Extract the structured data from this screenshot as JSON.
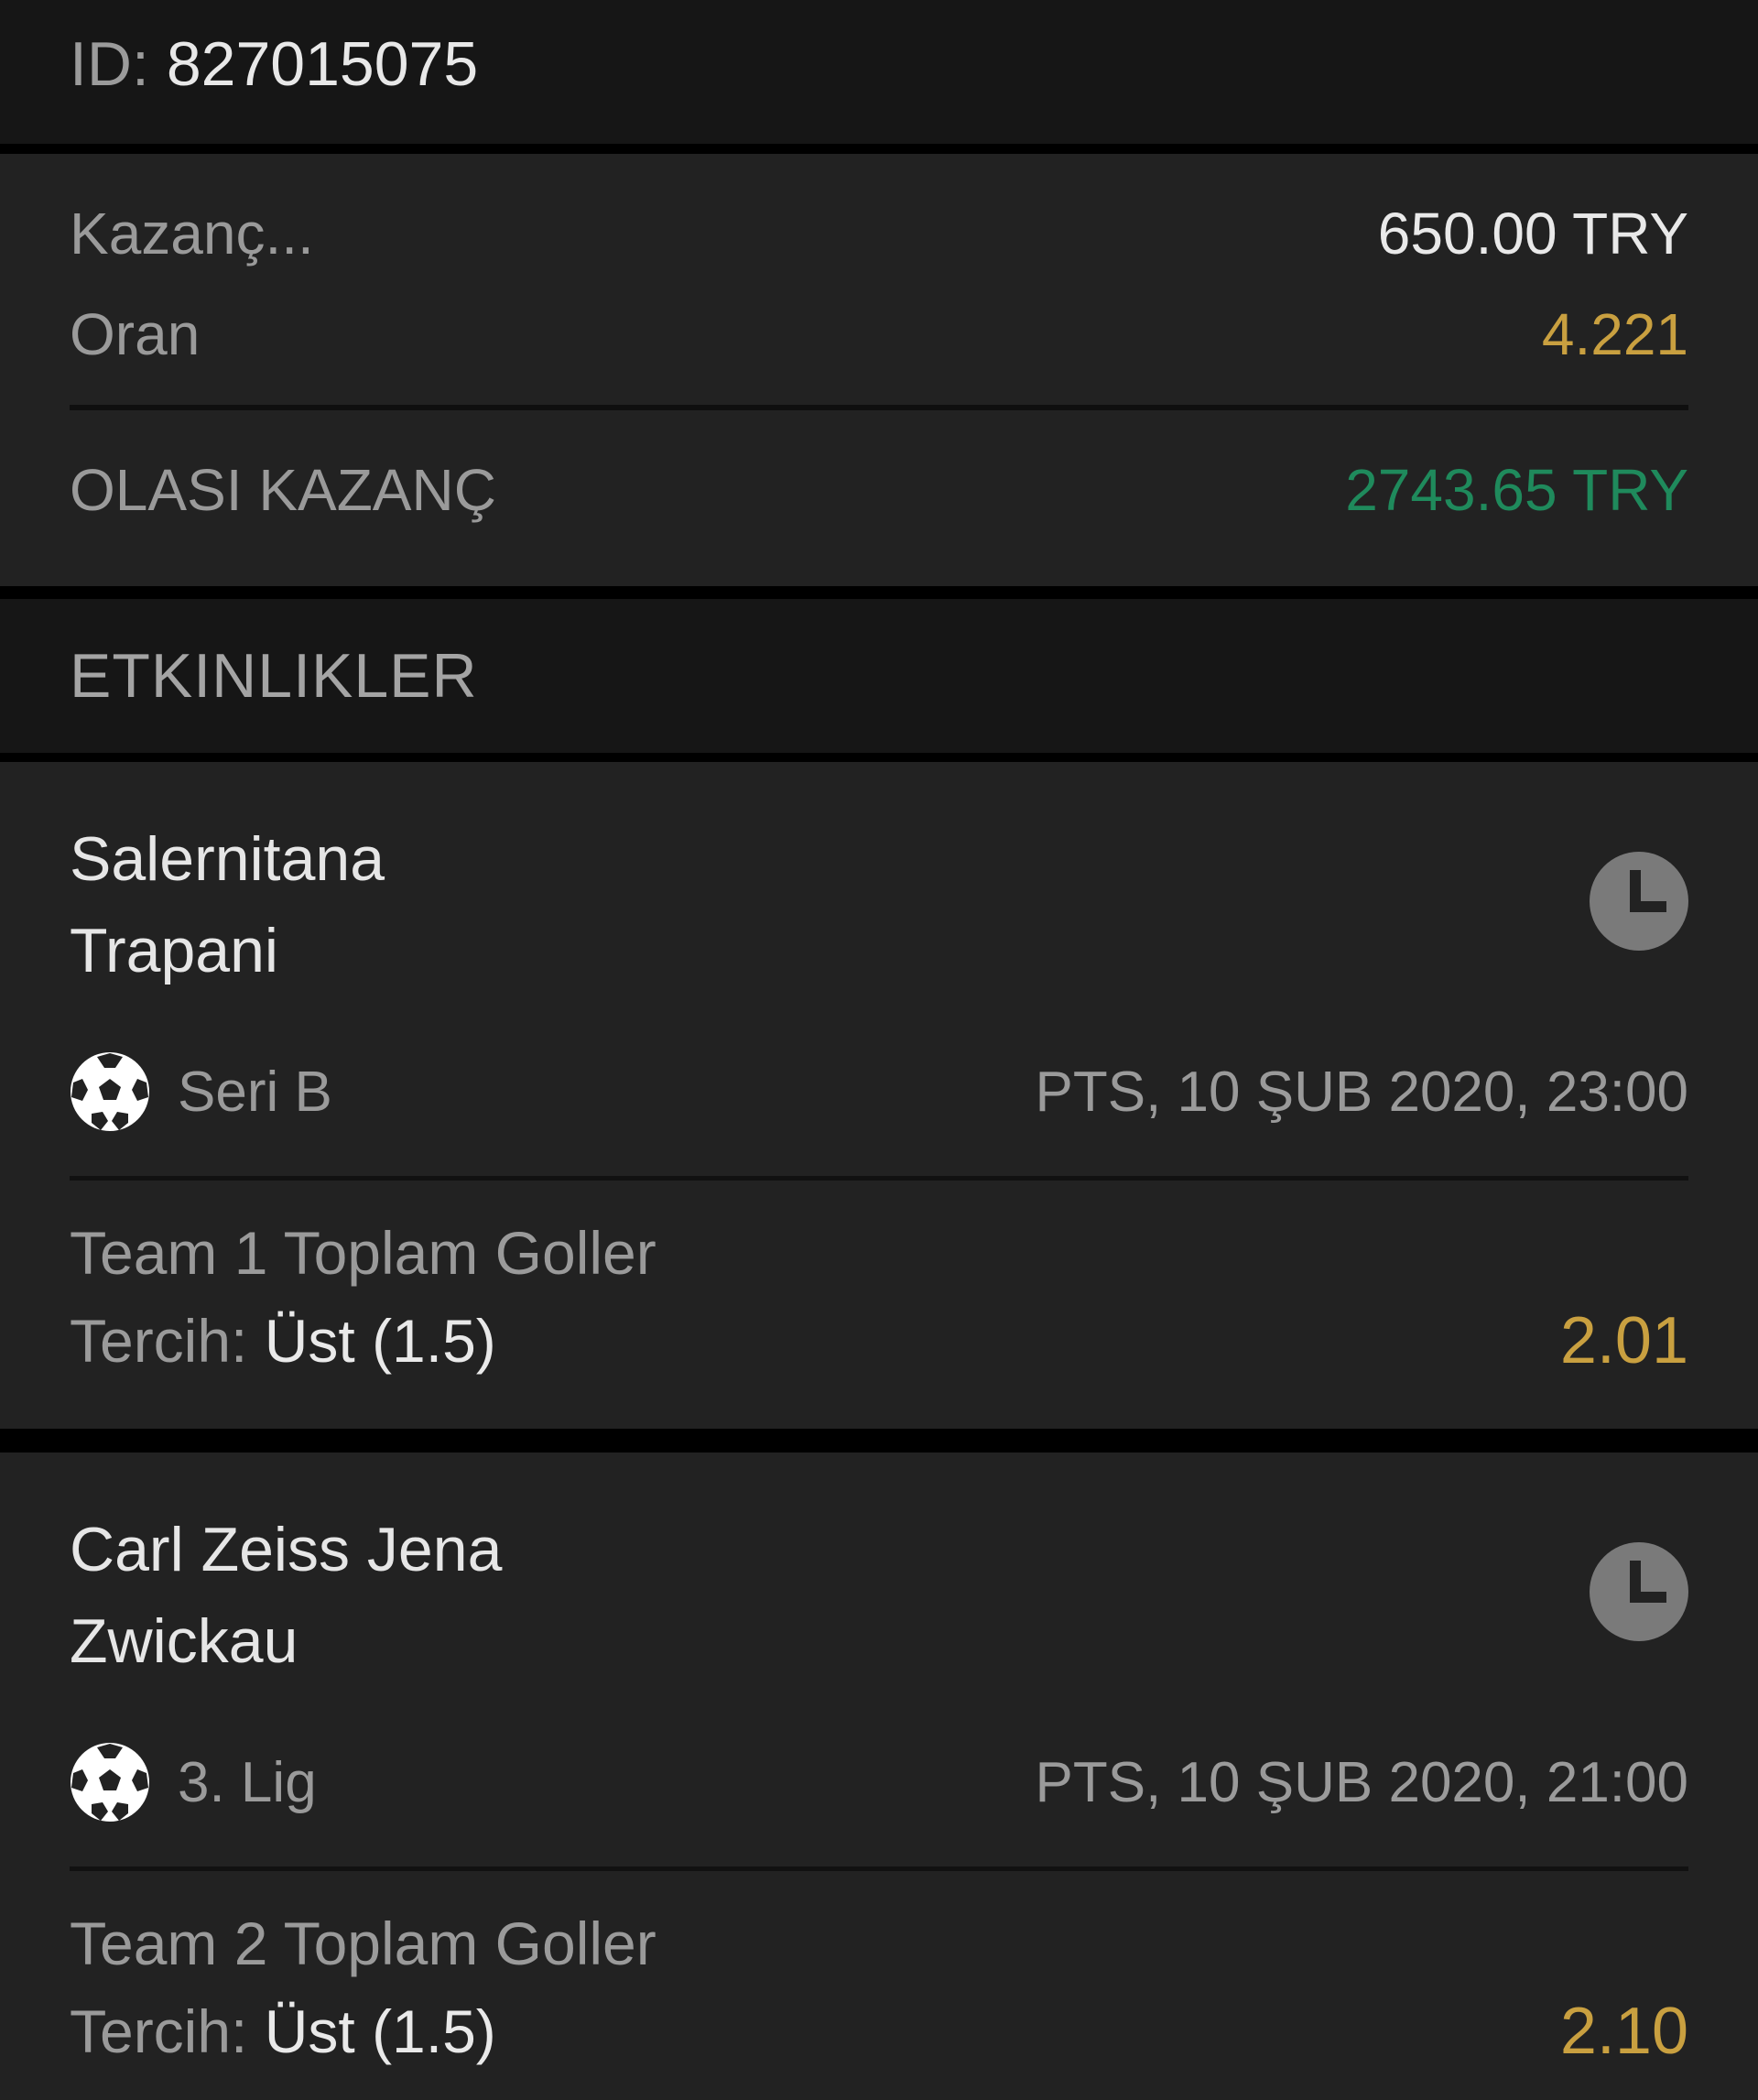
{
  "header": {
    "id_label": "ID:",
    "id_value": "827015075"
  },
  "summary": {
    "stake_label": "Kazanç...",
    "stake_value": "650.00 TRY",
    "odds_label": "Oran",
    "odds_value": "4.221",
    "potential_label": "OLASI KAZANÇ",
    "potential_value": "2743.65 TRY"
  },
  "section": {
    "title": "ETKINLIKLER"
  },
  "events": [
    {
      "home": "Salernitana",
      "away": "Trapani",
      "league": "Seri B",
      "datetime": "PTS, 10 ŞUB 2020, 23:00",
      "market": "Team 1 Toplam Goller",
      "pick_label": "Tercih:",
      "pick_value": "Üst (1.5)",
      "odd": "2.01"
    },
    {
      "home": "Carl Zeiss Jena",
      "away": "Zwickau",
      "league": "3. Lig",
      "datetime": "PTS, 10 ŞUB 2020, 21:00",
      "market": "Team 2 Toplam Goller",
      "pick_label": "Tercih:",
      "pick_value": "Üst (1.5)",
      "odd": "2.10"
    }
  ],
  "icons": {
    "clock": "clock-icon",
    "sport": "soccer-ball-icon"
  },
  "colors": {
    "gold": "#c9a040",
    "green": "#1f8a5c",
    "background": "#222222"
  }
}
